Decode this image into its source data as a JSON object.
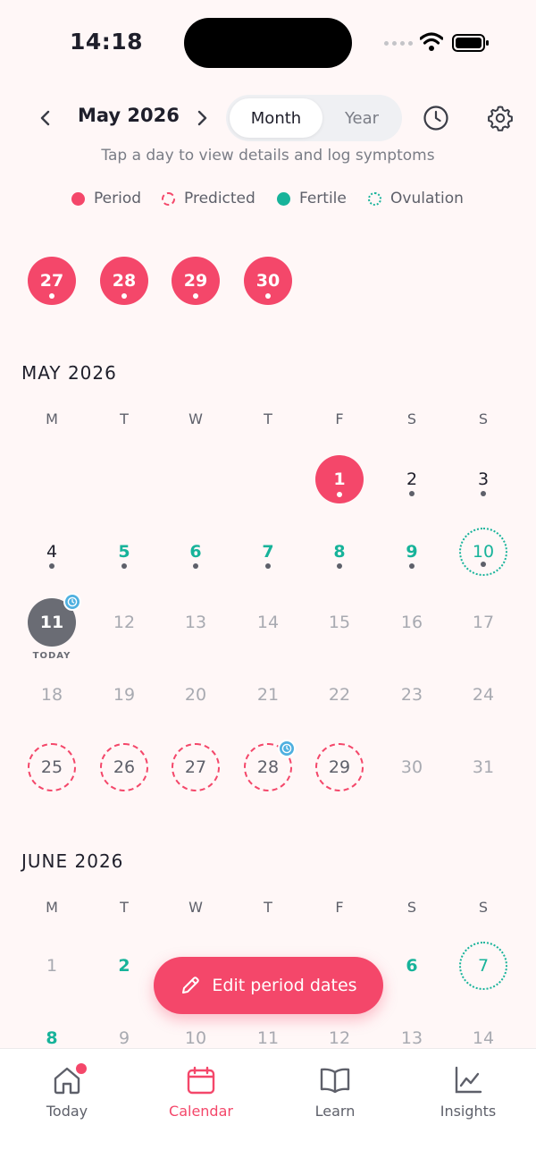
{
  "status_bar": {
    "time": "14:18"
  },
  "header": {
    "title": "May 2026",
    "view_month": "Month",
    "view_year": "Year"
  },
  "hint": "Tap a day to view details and log symptoms",
  "legend": {
    "period": "Period",
    "predicted": "Predicted",
    "fertile": "Fertile",
    "ovulation": "Ovulation"
  },
  "colors": {
    "period": "#f4476a",
    "fertile": "#17b39a",
    "today": "#6a6c74",
    "badge": "#4fb0e0"
  },
  "weekdays": [
    "M",
    "T",
    "W",
    "T",
    "F",
    "S",
    "S"
  ],
  "prev_month_tail": [
    "27",
    "28",
    "29",
    "30"
  ],
  "may": {
    "heading": "MAY 2026",
    "today_label": "TODAY",
    "days": {
      "d1": "1",
      "d2": "2",
      "d3": "3",
      "d4": "4",
      "d5": "5",
      "d6": "6",
      "d7": "7",
      "d8": "8",
      "d9": "9",
      "d10": "10",
      "d11": "11",
      "d12": "12",
      "d13": "13",
      "d14": "14",
      "d15": "15",
      "d16": "16",
      "d17": "17",
      "d18": "18",
      "d19": "19",
      "d20": "20",
      "d21": "21",
      "d22": "22",
      "d23": "23",
      "d24": "24",
      "d25": "25",
      "d26": "26",
      "d27": "27",
      "d28": "28",
      "d29": "29",
      "d30": "30",
      "d31": "31"
    }
  },
  "june": {
    "heading": "JUNE 2026",
    "days": {
      "d1": "1",
      "d2": "2",
      "d6": "6",
      "d7": "7",
      "d8": "8",
      "d9": "9",
      "d10": "10",
      "d11": "11",
      "d12": "12",
      "d13": "13",
      "d14": "14"
    }
  },
  "fab": {
    "label": "Edit period dates"
  },
  "tabs": {
    "today": "Today",
    "calendar": "Calendar",
    "learn": "Learn",
    "insights": "Insights"
  }
}
